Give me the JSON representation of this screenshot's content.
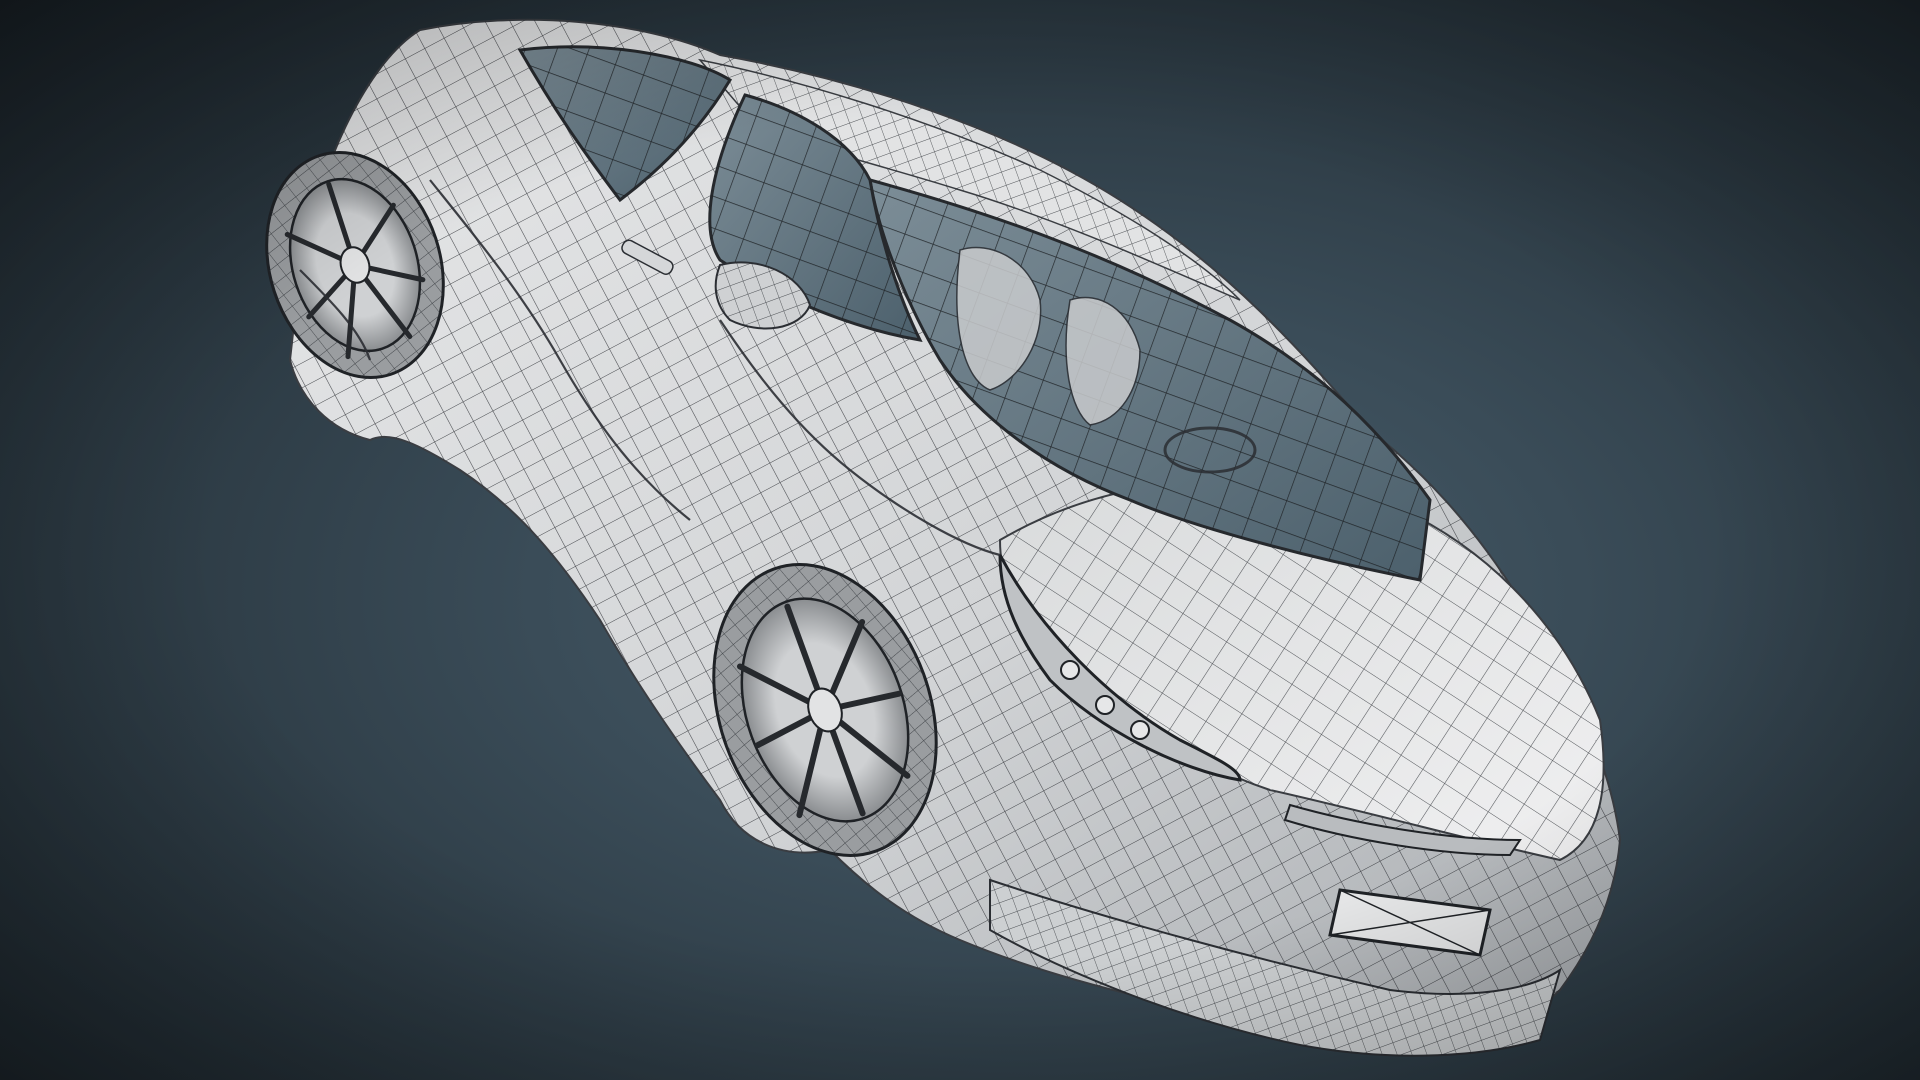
{
  "scene": {
    "subject": "car-wireframe-render",
    "colors": {
      "background_center": "#4a5f6c",
      "background_edge": "#1a2228",
      "body_fill": "#d9dadb",
      "body_shade": "#a9acaf",
      "wire": "#2a2d31",
      "glass": "#5f7480",
      "tire": "#6b6d70"
    }
  }
}
